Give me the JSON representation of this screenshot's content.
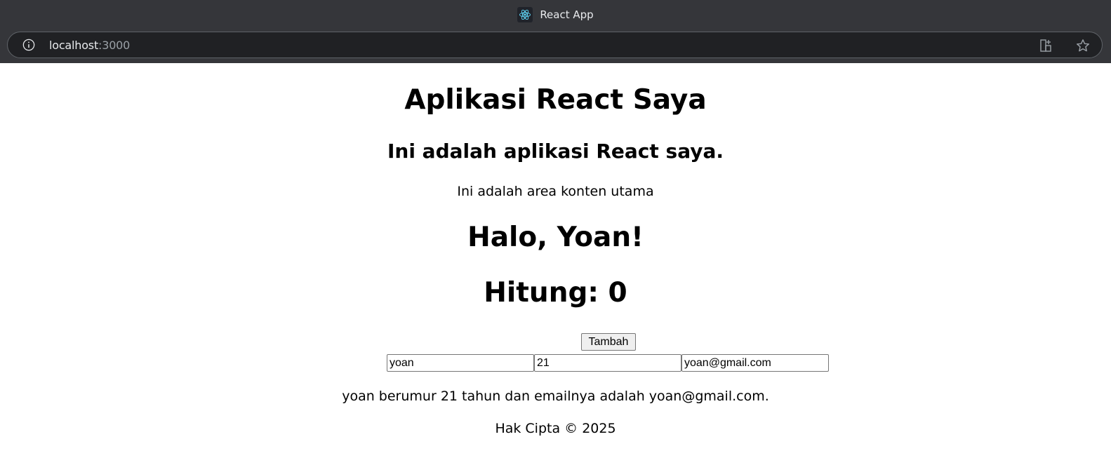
{
  "browser": {
    "tab_title": "React App",
    "url_host": "localhost",
    "url_port": ":3000"
  },
  "page": {
    "title": "Aplikasi React Saya",
    "subtitle": "Ini adalah aplikasi React saya.",
    "main_text": "Ini adalah area konten utama",
    "greeting": "Halo, Yoan!",
    "counter": "Hitung: 0",
    "add_button_label": "Tambah",
    "inputs": {
      "name": "yoan",
      "age": "21",
      "email": "yoan@gmail.com"
    },
    "summary": "yoan berumur 21 tahun dan emailnya adalah yoan@gmail.com.",
    "footer": "Hak Cipta © 2025"
  },
  "colors": {
    "chrome_bg": "#35363a",
    "omnibox_bg": "#202124",
    "react_brand": "#61dafb"
  }
}
